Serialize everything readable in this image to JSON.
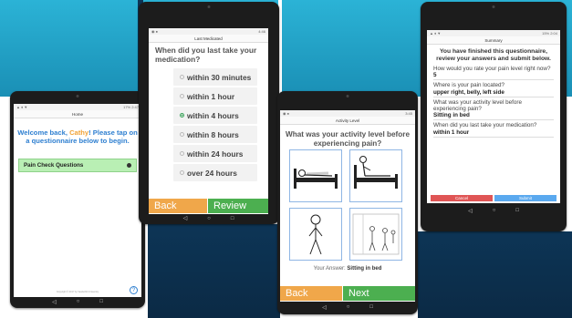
{
  "colors": {
    "accent_blue": "#2e7fd0",
    "accent_orange": "#f0a236",
    "back_orange": "#f0a74a",
    "next_green": "#4caf50",
    "pain_button_green": "#b9efb4",
    "cancel_red": "#e05555",
    "submit_blue": "#5aa9ef"
  },
  "home": {
    "status_right": "17% 2:47",
    "title": "Home",
    "welcome_prefix": "Welcome back, ",
    "user_name": "Cathy",
    "welcome_suffix": "! Please tap on a questionnaire below to begin.",
    "questionnaire_label": "Pain Check Questions",
    "copyright": "Copyright © 2017 by Vanderbilt University",
    "help_icon_label": "?",
    "nav": [
      "◁",
      "○",
      "□"
    ]
  },
  "medication": {
    "status_right": "4:46",
    "title": "Last Medicated",
    "question": "When did you last take your medication?",
    "options": [
      {
        "label": "within 30 minutes",
        "selected": false
      },
      {
        "label": "within 1 hour",
        "selected": false
      },
      {
        "label": "within 4 hours",
        "selected": true
      },
      {
        "label": "within 8 hours",
        "selected": false
      },
      {
        "label": "within 24 hours",
        "selected": false
      },
      {
        "label": "over 24 hours",
        "selected": false
      }
    ],
    "back_label": "Back",
    "next_label": "Review",
    "nav": [
      "◁",
      "○",
      "□"
    ]
  },
  "activity": {
    "status_right": "3:45",
    "title": "Activity Level",
    "question": "What was your activity level before experiencing pain?",
    "images": [
      "lying-in-bed",
      "sitting-in-bed",
      "standing",
      "walking"
    ],
    "answer_prefix": "Your Answer: ",
    "answer_value": "Sitting in bed",
    "back_label": "Back",
    "next_label": "Next",
    "nav": [
      "◁",
      "○",
      "□"
    ]
  },
  "summary": {
    "status_right": "15% 2:04",
    "title": "Summary",
    "heading": "You have finished this questionnaire, review your answers and submit below.",
    "items": [
      {
        "q": "How would you rate your pain level right now?",
        "a": "5"
      },
      {
        "q": "Where is your pain located?",
        "a": "upper right, belly, left side"
      },
      {
        "q": "What was your activity level before experiencing pain?",
        "a": "Sitting in bed"
      },
      {
        "q": "When did you last take your medication?",
        "a": "within 1 hour"
      }
    ],
    "cancel_label": "Cancel",
    "submit_label": "Submit",
    "nav": [
      "◁",
      "○",
      "□"
    ]
  }
}
